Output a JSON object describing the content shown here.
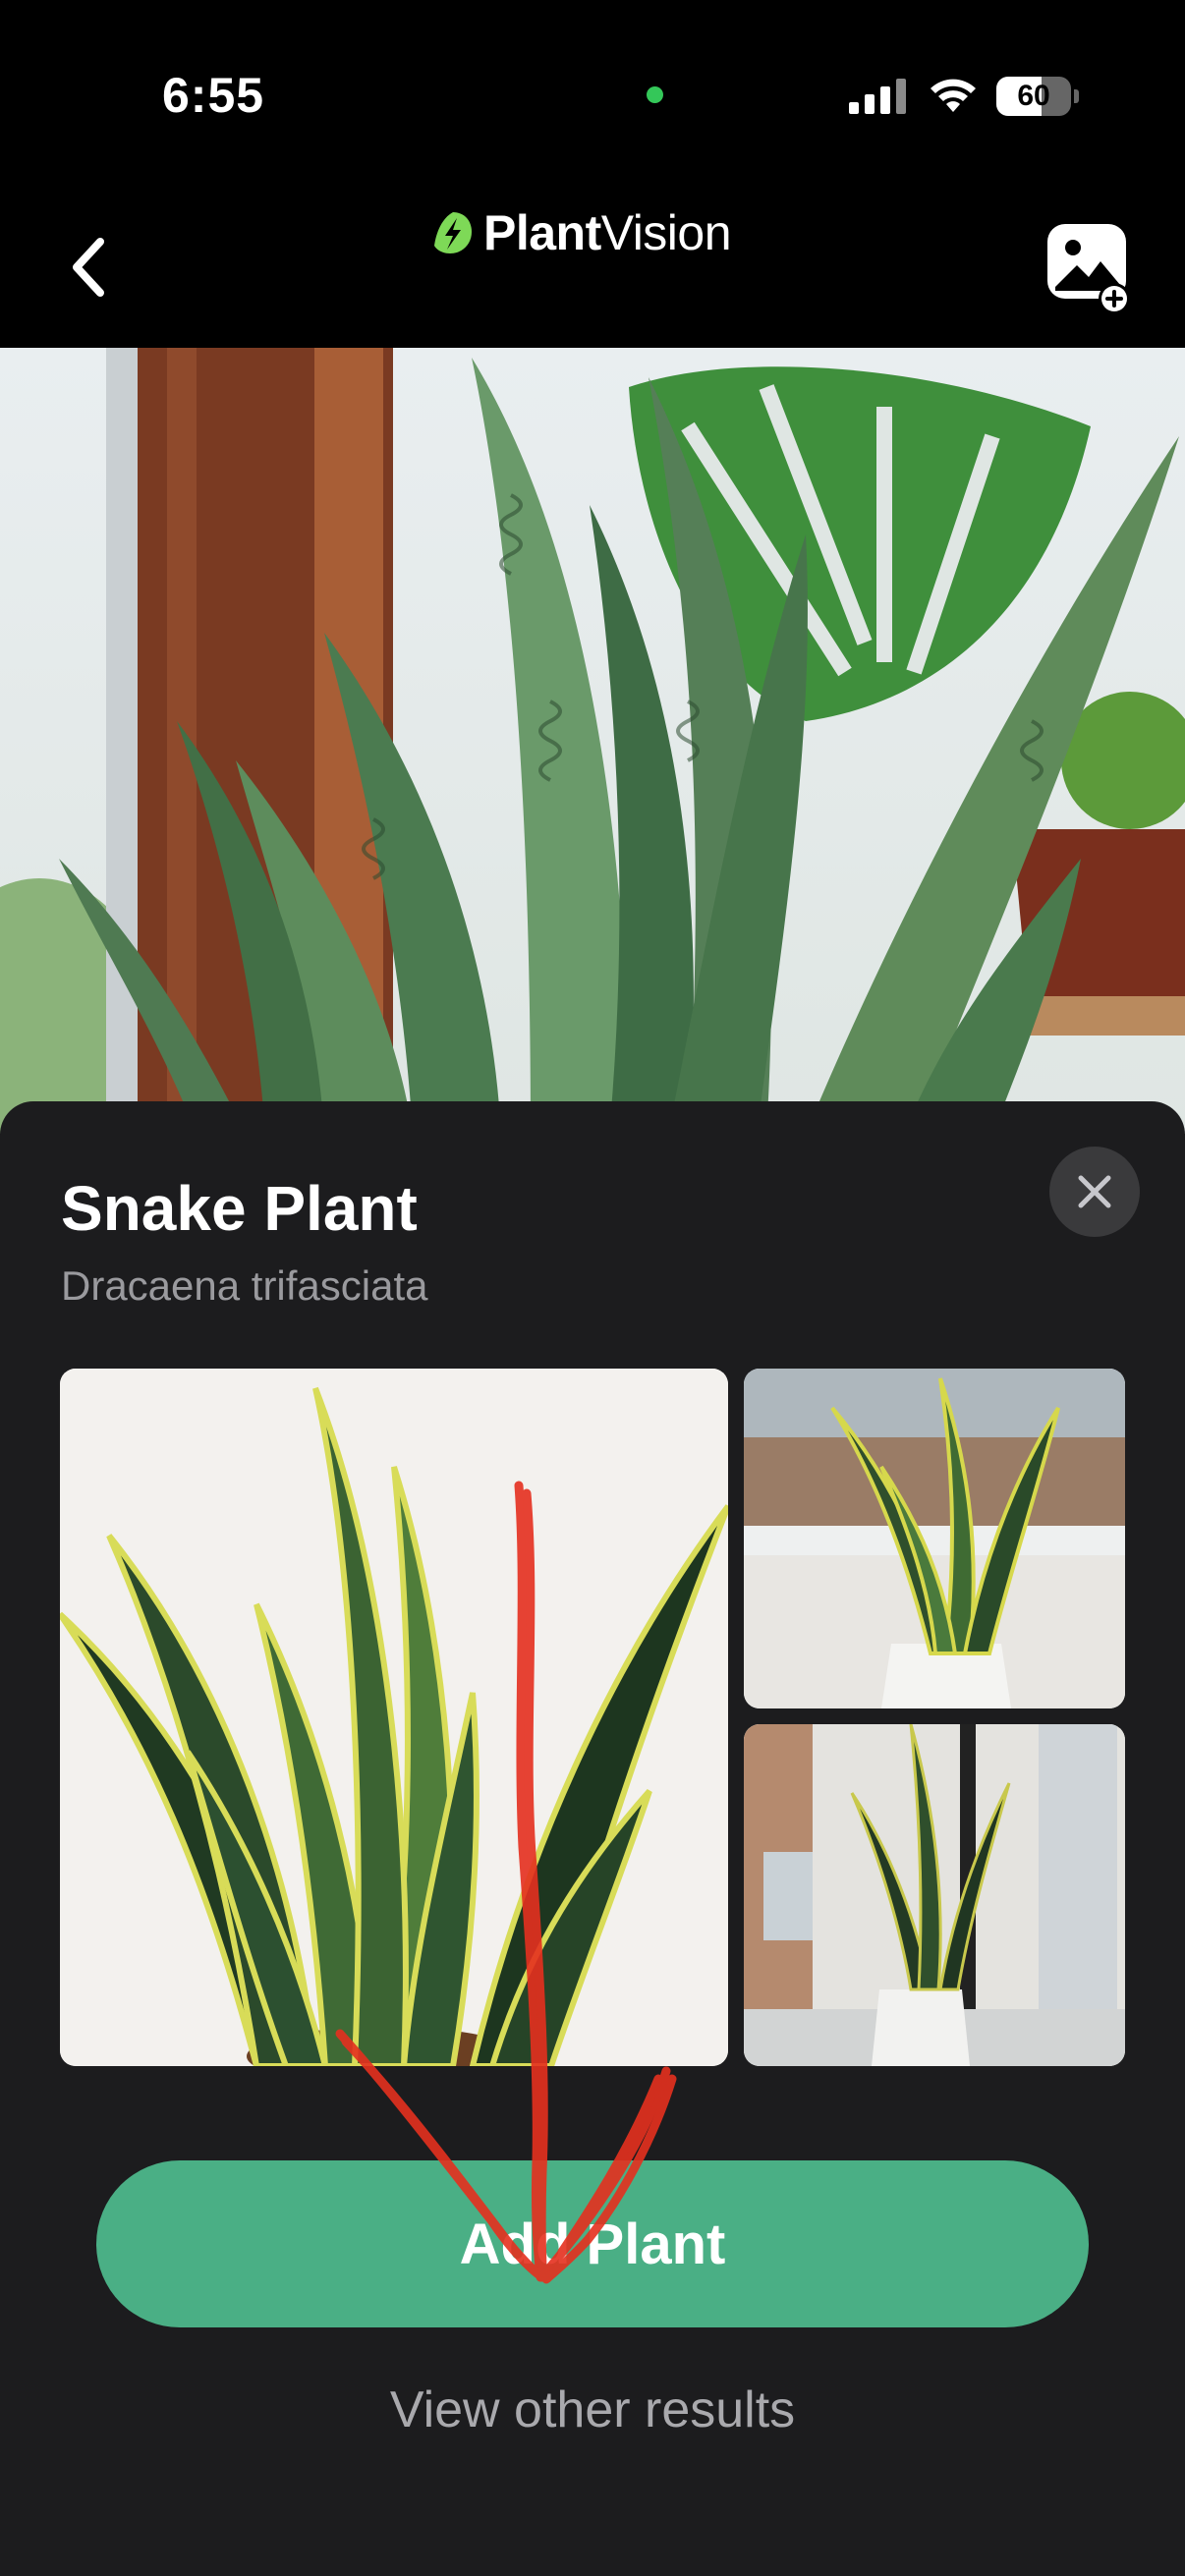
{
  "status_bar": {
    "time": "6:55",
    "battery_level": "60",
    "icons": [
      "cellular-signal-icon",
      "wifi-icon",
      "battery-icon"
    ]
  },
  "nav": {
    "brand_bold": "Plant",
    "brand_light": "Vision",
    "back_icon": "chevron-left-icon",
    "add_photo_icon": "image-add-icon"
  },
  "result": {
    "common_name": "Snake Plant",
    "scientific_name": "Dracaena trifasciata",
    "add_button_label": "Add Plant",
    "other_results_label": "View other results"
  },
  "colors": {
    "accent_green": "#4aaf85",
    "sheet_background": "#1c1c1e",
    "annotation_red": "#e5301f"
  }
}
